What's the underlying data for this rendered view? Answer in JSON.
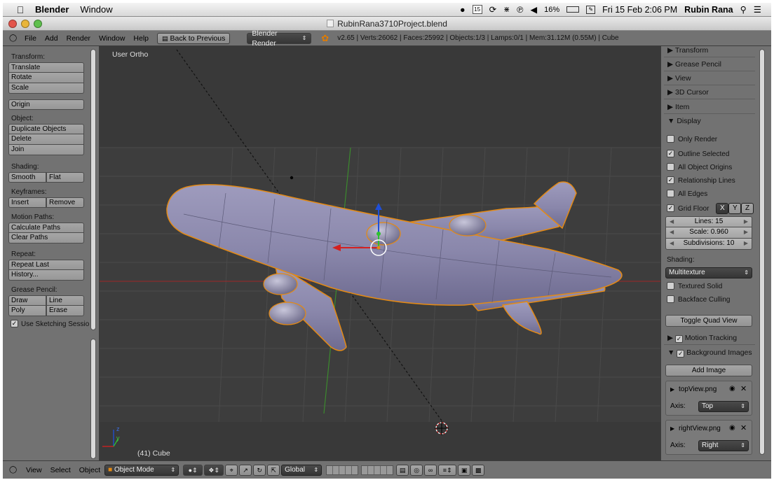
{
  "mac_menubar": {
    "app_name": "Blender",
    "menu_window": "Window",
    "calendar_day": "15",
    "battery": "16%",
    "datetime": "Fri 15 Feb  2:06 PM",
    "user": "Rubin Rana"
  },
  "window": {
    "title": "RubinRana3710Project.blend"
  },
  "info_header": {
    "menus": [
      "File",
      "Add",
      "Render",
      "Window",
      "Help"
    ],
    "back_button": "Back to Previous",
    "render_engine": "Blender Render",
    "stats": "v2.65 | Verts:26062 | Faces:25992 | Objects:1/3 | Lamps:0/1 | Mem:31.12M (0.55M) | Cube"
  },
  "tool_shelf": {
    "transform_label": "Transform:",
    "translate": "Translate",
    "rotate": "Rotate",
    "scale": "Scale",
    "origin": "Origin",
    "object_label": "Object:",
    "duplicate": "Duplicate Objects",
    "delete": "Delete",
    "join": "Join",
    "shading_label": "Shading:",
    "smooth": "Smooth",
    "flat": "Flat",
    "keyframes_label": "Keyframes:",
    "insert": "Insert",
    "remove": "Remove",
    "motion_paths_label": "Motion Paths:",
    "calculate_paths": "Calculate Paths",
    "clear_paths": "Clear Paths",
    "repeat_label": "Repeat:",
    "repeat_last": "Repeat Last",
    "history": "History...",
    "grease_pencil_label": "Grease Pencil:",
    "draw": "Draw",
    "line": "Line",
    "poly": "Poly",
    "erase": "Erase",
    "use_sketching": "Use Sketching Sessio"
  },
  "viewport": {
    "view_name": "User Ortho",
    "object_info": "(41) Cube",
    "axis_y": "y",
    "axis_z": "z"
  },
  "properties": {
    "transform": "Transform",
    "grease_pencil": "Grease Pencil",
    "view": "View",
    "cursor_3d": "3D Cursor",
    "item": "Item",
    "display": "Display",
    "only_render": "Only Render",
    "outline_selected": "Outline Selected",
    "all_object_origins": "All Object Origins",
    "relationship_lines": "Relationship Lines",
    "all_edges": "All Edges",
    "grid_floor": "Grid Floor",
    "axis_x": "X",
    "axis_y": "Y",
    "axis_z": "Z",
    "lines": "Lines: 15",
    "scale": "Scale: 0.960",
    "subdivisions": "Subdivisions: 10",
    "shading_label": "Shading:",
    "shading_value": "Multitexture",
    "textured_solid": "Textured Solid",
    "backface_culling": "Backface Culling",
    "toggle_quad_view": "Toggle Quad View",
    "motion_tracking": "Motion Tracking",
    "background_images": "Background Images",
    "add_image": "Add Image",
    "image1_name": "topView.png",
    "image1_axis_label": "Axis:",
    "image1_axis_value": "Top",
    "image2_name": "rightView.png",
    "image2_axis_label": "Axis:",
    "image2_axis_value": "Right"
  },
  "bottom_header": {
    "menu_view": "View",
    "menu_select": "Select",
    "menu_object": "Object",
    "mode": "Object Mode",
    "orientation": "Global"
  }
}
